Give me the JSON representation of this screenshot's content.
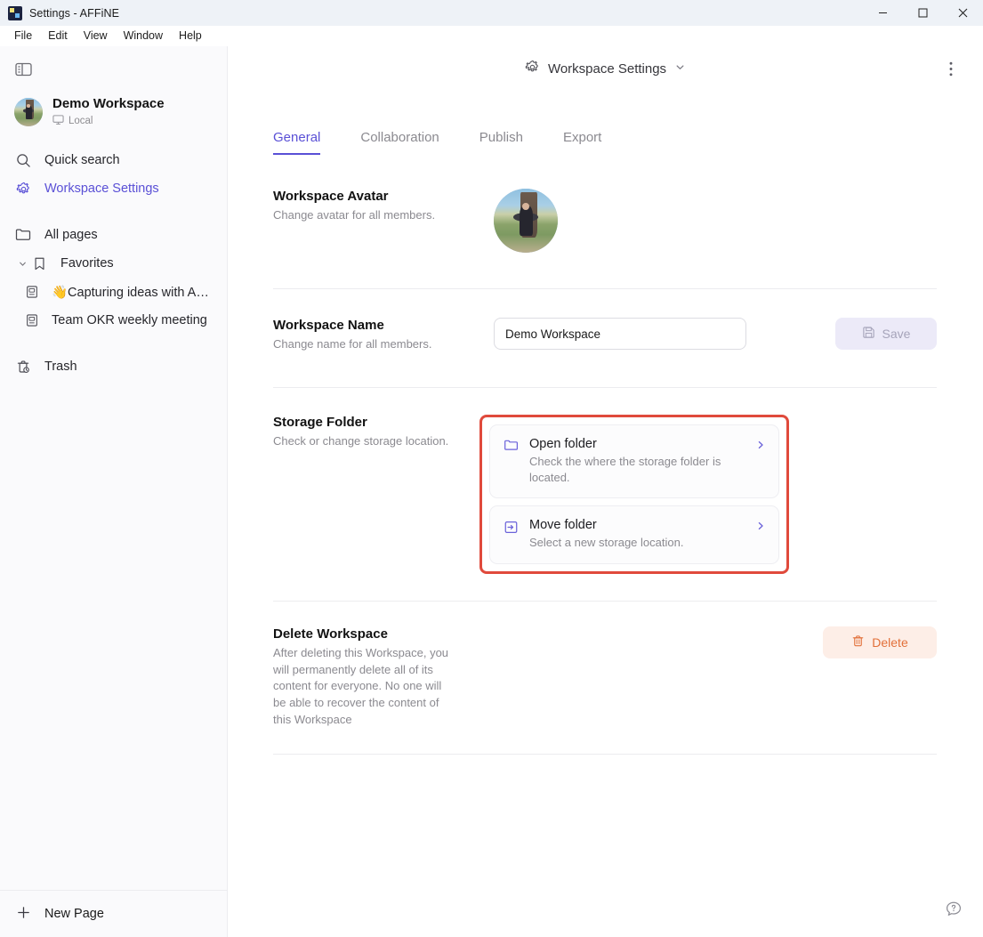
{
  "window": {
    "title": "Settings - AFFiNE",
    "app_icon": "affine-logo-icon",
    "minimize": "–",
    "maximize": "□",
    "close": "×"
  },
  "menubar": {
    "items": [
      "File",
      "Edit",
      "View",
      "Window",
      "Help"
    ]
  },
  "sidebar": {
    "toggle_icon": "sidebar-toggle-icon",
    "workspace": {
      "name": "Demo Workspace",
      "sub_label": "Local",
      "sub_icon": "monitor-icon",
      "avatar_icon": "workspace-avatar"
    },
    "nav_primary": [
      {
        "label": "Quick search",
        "icon": "search-icon",
        "active": false
      },
      {
        "label": "Workspace Settings",
        "icon": "gear-icon",
        "active": true
      }
    ],
    "nav_secondary": [
      {
        "label": "All pages",
        "icon": "folder-icon"
      }
    ],
    "favorites": {
      "label": "Favorites",
      "icon": "bookmark-icon",
      "chevron": "chevron-down-icon",
      "items": [
        {
          "label": "👋Capturing ideas with AF...",
          "icon": "page-icon"
        },
        {
          "label": "Team OKR weekly meeting",
          "icon": "page-icon"
        }
      ]
    },
    "trash": {
      "label": "Trash",
      "icon": "trash-icon"
    },
    "footer": {
      "new_page_label": "New Page",
      "new_page_icon": "plus-icon"
    }
  },
  "header": {
    "title": "Workspace Settings",
    "icon": "gear-icon",
    "chevron": "chevron-down-icon",
    "more_icon": "more-vertical-icon"
  },
  "tabs": [
    {
      "label": "General",
      "active": true
    },
    {
      "label": "Collaboration",
      "active": false
    },
    {
      "label": "Publish",
      "active": false
    },
    {
      "label": "Export",
      "active": false
    }
  ],
  "sections": {
    "avatar": {
      "title": "Workspace Avatar",
      "desc": "Change avatar for all members.",
      "avatar_icon": "workspace-avatar-large"
    },
    "name": {
      "title": "Workspace Name",
      "desc": "Change name for all members.",
      "input_value": "Demo Workspace",
      "input_placeholder": "Workspace name",
      "save_label": "Save",
      "save_icon": "save-disk-icon",
      "save_disabled": true
    },
    "storage": {
      "title": "Storage Folder",
      "desc": "Check or change storage location.",
      "highlight_color": "#e04a3c",
      "cards": [
        {
          "title": "Open folder",
          "desc": "Check the where the storage folder is located.",
          "icon": "folder-icon",
          "chevron": "chevron-right-icon"
        },
        {
          "title": "Move folder",
          "desc": "Select a new storage location.",
          "icon": "move-folder-icon",
          "chevron": "chevron-right-icon"
        }
      ]
    },
    "delete": {
      "title": "Delete Workspace",
      "desc": "After deleting this Workspace, you will permanently delete all of its content for everyone. No one will be able to recover the content of this Workspace",
      "button_label": "Delete",
      "button_icon": "trash-icon"
    }
  },
  "help": {
    "icon": "help-chat-icon"
  },
  "colors": {
    "accent": "#5a50d6",
    "titlebar_bg": "#eef2f7",
    "sidebar_bg": "#fafafc",
    "muted_text": "#8b8a90",
    "danger": "#e2703a",
    "highlight": "#e04a3c"
  }
}
